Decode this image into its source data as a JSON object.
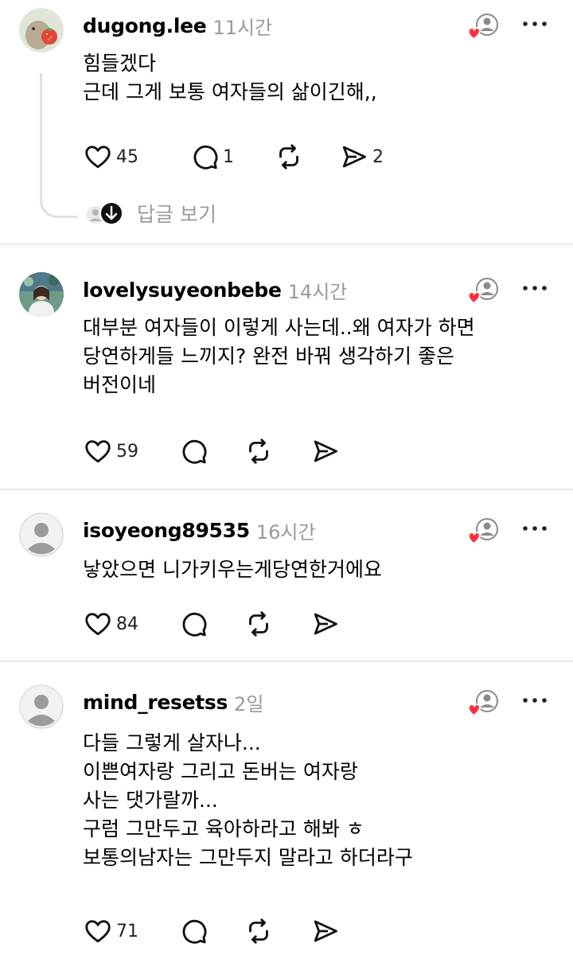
{
  "posts": [
    {
      "username": "dugong.lee",
      "time": "11시간",
      "lines": [
        "힘들겠다",
        "근데 그게 보통 여자들의 삶이긴해,,"
      ],
      "likes": "45",
      "comments": "1",
      "shares": "2",
      "replies_label": "답글 보기",
      "avatar": "dugong-strawberry-avatar"
    },
    {
      "username": "lovelysuyeonbebe",
      "time": "14시간",
      "lines": [
        "대부분 여자들이 이렇게 사는데..왜 여자가 하면",
        "당연하게들 느끼지? 완전 바꿔 생각하기 좋은",
        "버전이네"
      ],
      "likes": "59",
      "avatar": "photo-avatar"
    },
    {
      "username": "isoyeong89535",
      "time": "16시간",
      "lines": [
        "낳았으면 니가키우는게당연한거에요"
      ],
      "likes": "84",
      "avatar": "default-avatar"
    },
    {
      "username": "mind_resetss",
      "time": "2일",
      "lines": [
        "다들 그렇게 살자나...",
        "이쁜여자랑 그리고 돈버는 여자랑",
        "사는 댓가랄까...",
        "구럼 그만두고 육아하라고 해봐 ㅎ",
        "보통의남자는 그만두지 말라고 하더라구"
      ],
      "likes": "71",
      "avatar": "default-avatar"
    }
  ],
  "icons": {
    "like": "heart-outline-icon",
    "comment": "speech-bubble-icon",
    "repost": "repost-arrows-icon",
    "share": "send-arrow-icon",
    "more": "more-dots-icon",
    "liked_by_author": "author-liked-badge-icon"
  },
  "colors": {
    "heart_red": "#ff3040",
    "muted_text": "#9a9a9a",
    "divider": "#ebebeb"
  }
}
